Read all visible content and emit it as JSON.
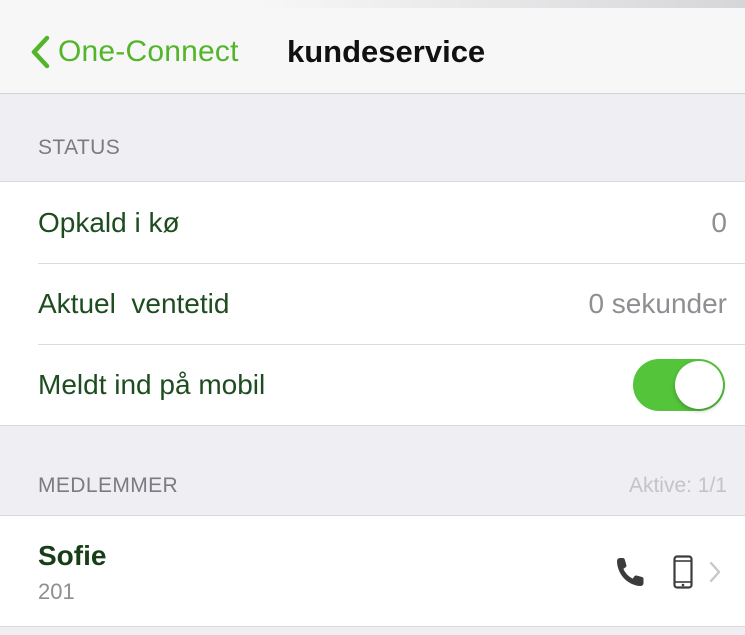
{
  "navbar": {
    "back_label": "One-Connect",
    "title": "kundeservice",
    "accent": "#53b52a"
  },
  "status": {
    "header": "STATUS",
    "rows": [
      {
        "label": "Opkald i kø",
        "value": "0"
      },
      {
        "label": "Aktuel  ventetid",
        "value": "0 sekunder"
      },
      {
        "label": "Meldt ind på mobil",
        "toggle_on": true
      }
    ]
  },
  "members": {
    "header": "MEDLEMMER",
    "active_label": "Aktive: 1/1",
    "items": [
      {
        "name": "Sofie",
        "extension": "201",
        "icons": [
          "phone-icon",
          "mobile-icon",
          "chevron-right-icon"
        ]
      }
    ]
  },
  "colors": {
    "toggle_on": "#54c43b",
    "label_text": "#1d4d1f",
    "secondary_text": "#8e8e93"
  }
}
